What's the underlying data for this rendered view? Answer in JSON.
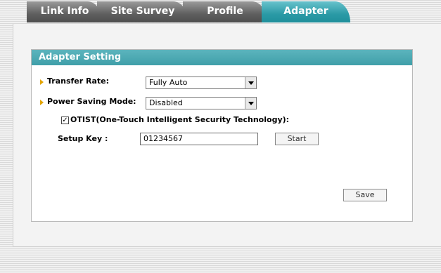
{
  "tabs": [
    {
      "label": "Link Info",
      "active": false
    },
    {
      "label": "Site Survey",
      "active": false
    },
    {
      "label": "Profile",
      "active": false
    },
    {
      "label": "Adapter",
      "active": true
    }
  ],
  "panel": {
    "title": "Adapter Setting",
    "transfer_rate": {
      "label": "Transfer Rate:",
      "value": "Fully Auto"
    },
    "power_saving": {
      "label": "Power Saving Mode:",
      "value": "Disabled"
    },
    "otist": {
      "label": "OTIST(One-Touch Intelligent Security Technology):",
      "checked": true,
      "check_mark": "✓"
    },
    "setup_key": {
      "label": "Setup Key :",
      "value": "01234567"
    },
    "start_button": "Start",
    "save_button": "Save"
  },
  "colors": {
    "accent": "#3f9fa9",
    "arrow": "#e3a400"
  }
}
